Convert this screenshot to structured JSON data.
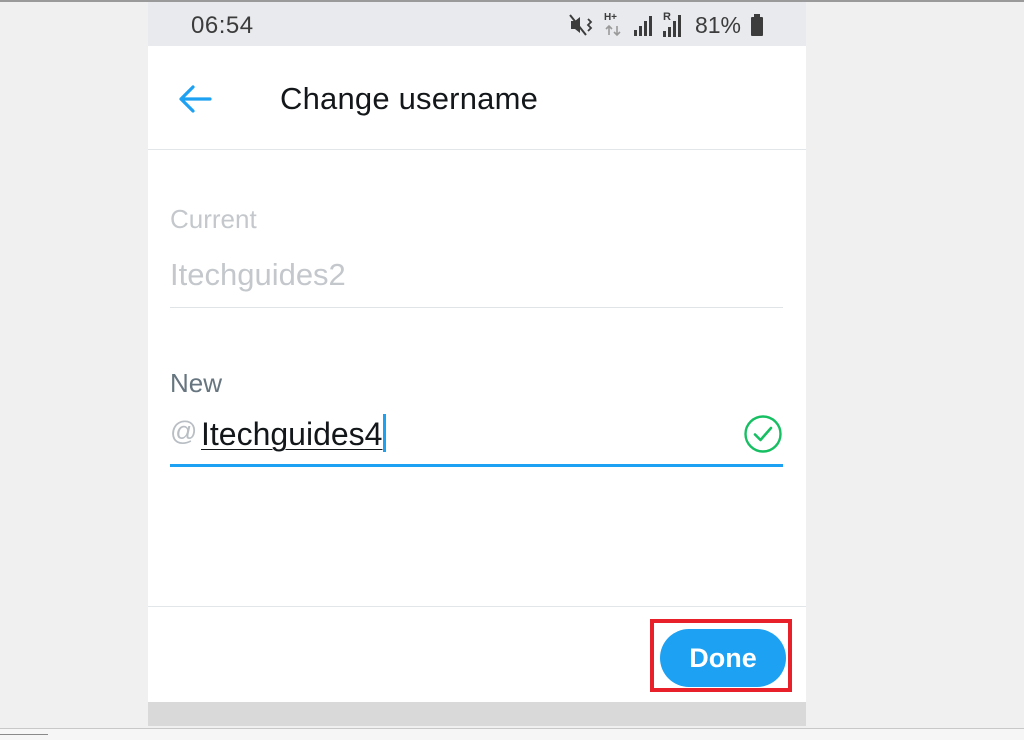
{
  "status_bar": {
    "time": "06:54",
    "network_type": "H+",
    "sim_roaming_label": "R",
    "battery_percent": "81%",
    "icons": [
      "mute-vibrate-icon",
      "data-transfer-icon",
      "signal-icon",
      "signal-roaming-icon",
      "battery-icon"
    ]
  },
  "header": {
    "back_icon": "arrow-left-icon",
    "title": "Change username"
  },
  "form": {
    "current_label": "Current",
    "current_value": "Itechguides2",
    "new_label": "New",
    "new_prefix": "@",
    "new_value": "Itechguides4",
    "valid_icon": "check-circle-icon"
  },
  "footer": {
    "done_label": "Done"
  },
  "colors": {
    "accent": "#1da1f2",
    "valid": "#17bf63",
    "highlight": "#e8202a",
    "status_bar_bg": "#e8eaed"
  }
}
